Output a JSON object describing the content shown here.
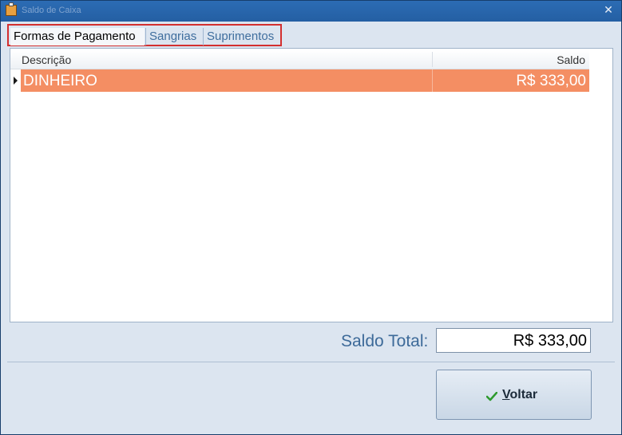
{
  "window": {
    "title": "Saldo de Caixa",
    "close_glyph": "✕"
  },
  "tabs": [
    {
      "label": "Formas de Pagamento",
      "active": true
    },
    {
      "label": "Sangrias",
      "active": false
    },
    {
      "label": "Suprimentos",
      "active": false
    }
  ],
  "grid": {
    "columns": {
      "descricao": "Descrição",
      "saldo": "Saldo"
    },
    "rows": [
      {
        "descricao": "DINHEIRO",
        "saldo": "R$ 333,00",
        "selected": true
      }
    ]
  },
  "total": {
    "label": "Saldo Total:",
    "value": "R$ 333,00"
  },
  "buttons": {
    "voltar": {
      "label_first": "V",
      "label_rest": "oltar",
      "icon": "check-icon"
    }
  },
  "colors": {
    "selected_row": "#f48e63",
    "highlight_border": "#d32f2f",
    "titlebar": "#2c6cb4"
  }
}
